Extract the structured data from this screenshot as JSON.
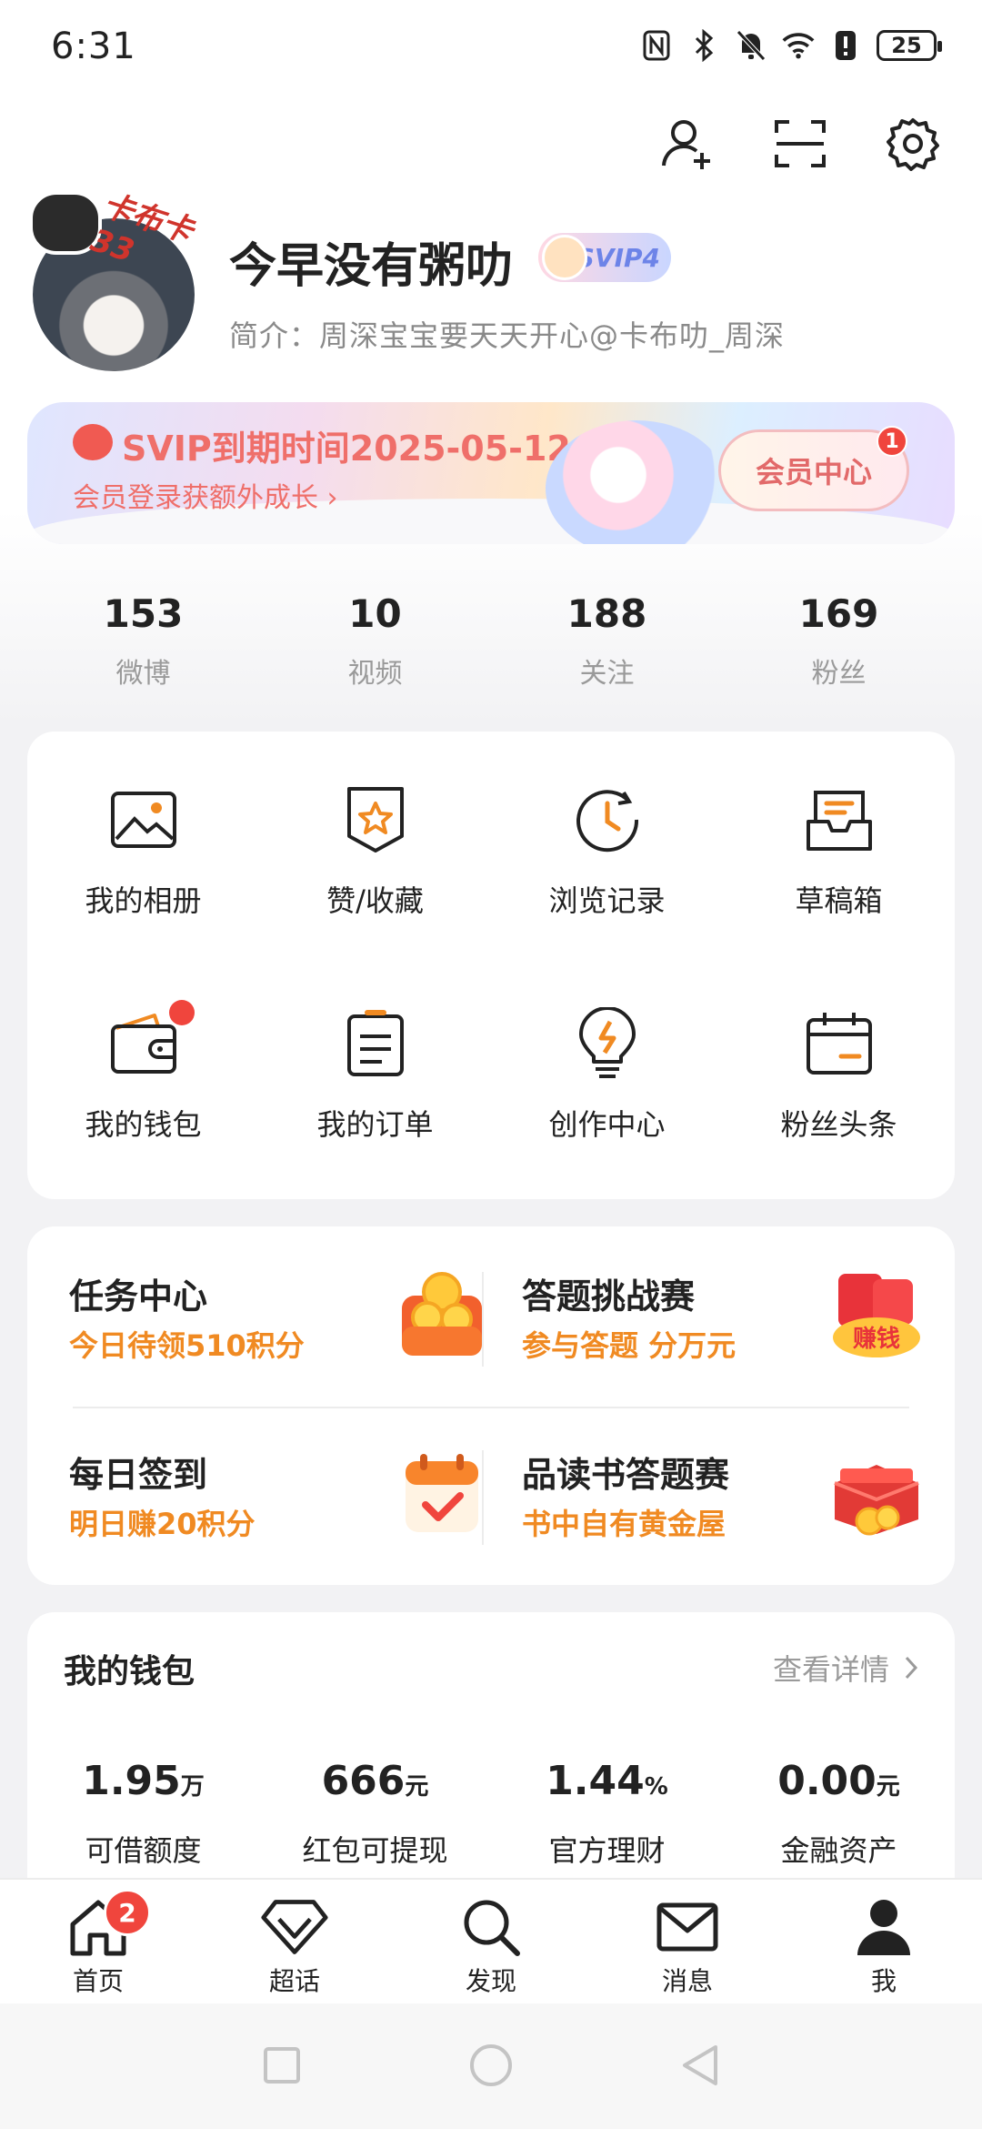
{
  "status": {
    "time": "6:31",
    "battery": "25"
  },
  "profile": {
    "name": "今早没有粥叻",
    "svip_badge": "SVIP4",
    "bio": "简介：周深宝宝要天天开心@卡布叻_周深",
    "avatar_tag": "卡布卡33"
  },
  "vip_banner": {
    "title": "SVIP到期时间2025-05-12",
    "subtitle": "会员登录获额外成长 ›",
    "button": "会员中心",
    "button_badge": "1"
  },
  "stats": [
    {
      "value": "153",
      "label": "微博"
    },
    {
      "value": "10",
      "label": "视频"
    },
    {
      "value": "188",
      "label": "关注"
    },
    {
      "value": "169",
      "label": "粉丝"
    }
  ],
  "grid": [
    {
      "label": "我的相册",
      "icon": "photo-album-icon"
    },
    {
      "label": "赞/收藏",
      "icon": "favorite-star-icon"
    },
    {
      "label": "浏览记录",
      "icon": "history-clock-icon"
    },
    {
      "label": "草稿箱",
      "icon": "draft-box-icon"
    },
    {
      "label": "我的钱包",
      "icon": "wallet-icon"
    },
    {
      "label": "我的订单",
      "icon": "order-list-icon"
    },
    {
      "label": "创作中心",
      "icon": "lightbulb-icon"
    },
    {
      "label": "粉丝头条",
      "icon": "calendar-icon"
    }
  ],
  "tasks": [
    {
      "title": "任务中心",
      "subtitle": "今日待领510积分",
      "icon": "coin-stack-icon"
    },
    {
      "title": "答题挑战赛",
      "subtitle": "参与答题 分万元",
      "icon": "red-envelope-icon",
      "art_text": "赚钱"
    },
    {
      "title": "每日签到",
      "subtitle": "明日赚20积分",
      "icon": "checkin-calendar-icon"
    },
    {
      "title": "品读书答题赛",
      "subtitle": "书中自有黄金屋",
      "icon": "gift-box-icon"
    }
  ],
  "wallet": {
    "title": "我的钱包",
    "link": "查看详情",
    "items": [
      {
        "value": "1.95",
        "unit": "万",
        "label": "可借额度"
      },
      {
        "value": "666",
        "unit": "元",
        "label": "红包可提现"
      },
      {
        "value": "1.44",
        "unit": "%",
        "label": "官方理财"
      },
      {
        "value": "0.00",
        "unit": "元",
        "label": "金融资产"
      }
    ]
  },
  "tabbar": [
    {
      "label": "首页",
      "icon": "home-icon",
      "badge": "2"
    },
    {
      "label": "超话",
      "icon": "diamond-icon"
    },
    {
      "label": "发现",
      "icon": "search-icon"
    },
    {
      "label": "消息",
      "icon": "mail-icon"
    },
    {
      "label": "我",
      "icon": "profile-icon"
    }
  ],
  "colors": {
    "accent": "#f08a22",
    "badge": "#f0453d",
    "vip": "#ef6f6a"
  }
}
